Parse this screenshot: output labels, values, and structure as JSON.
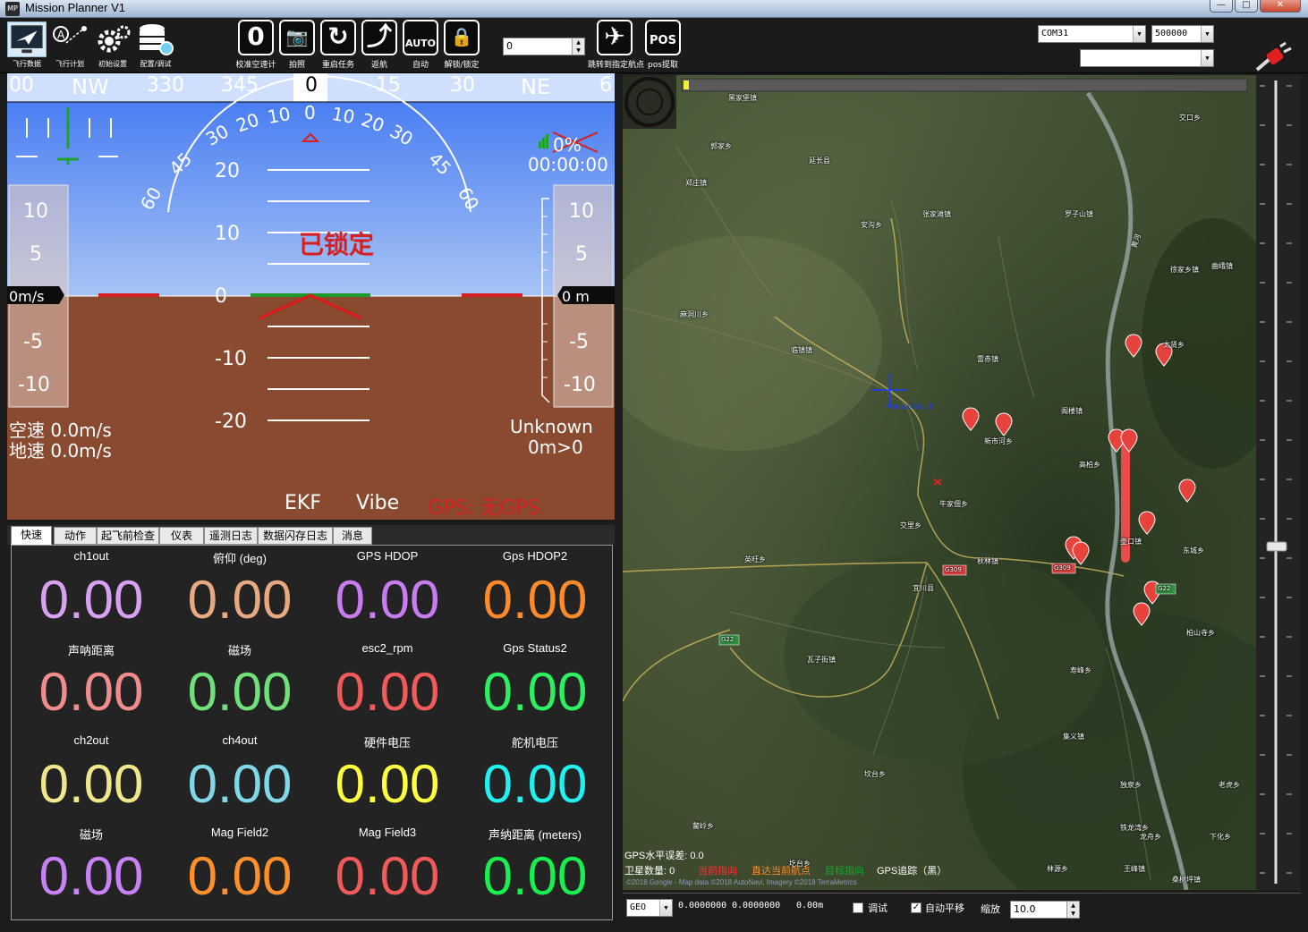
{
  "window": {
    "title": "Mission Planner V1",
    "icon_text": "MP",
    "minimize": "—",
    "maximize": "□",
    "close": "✕"
  },
  "nav": [
    {
      "label": "飞行数据"
    },
    {
      "label": "飞行计划"
    },
    {
      "label": "初始设置"
    },
    {
      "label": "配置/调试"
    }
  ],
  "actions": [
    {
      "symbol": "0",
      "label": "校准空速计"
    },
    {
      "symbol": "📷",
      "label": "拍照"
    },
    {
      "symbol": "↻",
      "label": "重启任务"
    },
    {
      "symbol": "⤴",
      "label": "返航"
    },
    {
      "symbol": "AUTO",
      "label": "自动"
    },
    {
      "symbol": "🔒",
      "label": "解锁/锁定"
    },
    {
      "symbol": "✈",
      "label": "跳转到指定航点"
    },
    {
      "symbol": "POS",
      "label": "pos提取"
    }
  ],
  "waypoint_spin": {
    "value": "0"
  },
  "connection": {
    "port": "COM31",
    "baud": "500000",
    "link_stats": "",
    "connect_label": "连接"
  },
  "hud": {
    "heading_tape": [
      "00",
      "NW",
      "330",
      "345",
      "0",
      "15",
      "30",
      "NE",
      "6"
    ],
    "roll_scale": [
      "60",
      "45",
      "30",
      "20",
      "10",
      "0",
      "10",
      "20",
      "30",
      "45",
      "60"
    ],
    "pitch_labels": [
      "20",
      "10",
      "0",
      "-10",
      "-20"
    ],
    "speed_tape": [
      "10",
      "5",
      "-5",
      "-10"
    ],
    "alt_tape": [
      "10",
      "5",
      "-5",
      "-10"
    ],
    "speed_readout": "0m/s",
    "alt_readout": "0 m",
    "status_text": "已锁定",
    "battery_percent": "0%",
    "flight_timer": "00:00:00",
    "airspeed": "空速 0.0m/s",
    "groundspeed": "地速 0.0m/s",
    "mode": "Unknown",
    "wp_distance": "0m>0",
    "ekf": "EKF",
    "vibe": "Vibe",
    "gps": "GPS: 无GPS"
  },
  "tabs": [
    "快速",
    "动作",
    "起飞前检查",
    "仪表",
    "遥测日志",
    "数据闪存日志",
    "消息"
  ],
  "quick": [
    {
      "name": "ch1out",
      "value": "0.00",
      "color": "#d8a0f0"
    },
    {
      "name": "俯仰 (deg)",
      "value": "0.00",
      "color": "#e8a880"
    },
    {
      "name": "GPS HDOP",
      "value": "0.00",
      "color": "#c87cf0"
    },
    {
      "name": "Gps HDOP2",
      "value": "0.00",
      "color": "#ff8a2a"
    },
    {
      "name": "声呐距离",
      "value": "0.00",
      "color": "#f08c8c"
    },
    {
      "name": "磁场",
      "value": "0.00",
      "color": "#6fe07a"
    },
    {
      "name": "esc2_rpm",
      "value": "0.00",
      "color": "#f05a5a"
    },
    {
      "name": "Gps Status2",
      "value": "0.00",
      "color": "#2df060"
    },
    {
      "name": "ch2out",
      "value": "0.00",
      "color": "#f0e68c"
    },
    {
      "name": "ch4out",
      "value": "0.00",
      "color": "#7fd8e8"
    },
    {
      "name": "硬件电压",
      "value": "0.00",
      "color": "#ffff40"
    },
    {
      "name": "舵机电压",
      "value": "0.00",
      "color": "#20f0f0"
    },
    {
      "name": "磁场",
      "value": "0.00",
      "color": "#c882f5"
    },
    {
      "name": "Mag Field2",
      "value": "0.00",
      "color": "#ff8f2a"
    },
    {
      "name": "Mag Field3",
      "value": "0.00",
      "color": "#f05a5a"
    },
    {
      "name": "声纳距离 (meters)",
      "value": "0.00",
      "color": "#18f050"
    }
  ],
  "map": {
    "places": [
      "黑家堡镇",
      "郭家乡",
      "延长县",
      "郑庄镇",
      "交口乡",
      "张家滩镇",
      "罗子山镇",
      "安沟乡",
      "徐家乡镇",
      "曲峨镇",
      "麻洞川乡",
      "临镇镇",
      "雷赤镇",
      "新市河乡",
      "阁楼镇",
      "高柏乡",
      "牛家佃乡",
      "交里乡",
      "英旺乡",
      "秋林镇",
      "宜川县",
      "东城乡",
      "瓦子街镇",
      "柏山寺乡",
      "寿峰乡",
      "坎台乡",
      "鳖岭乡",
      "独泉乡",
      "圪台乡",
      "林源乡",
      "王峰镇",
      "桑树坪镇",
      "下化乡",
      "老虎乡",
      "集义镇",
      "壶口镇",
      "龙舟乡",
      "铁龙湾乡",
      "太贤乡"
    ],
    "road_labels": [
      "G309",
      "G309",
      "G22",
      "G22"
    ],
    "river_label": "黄河",
    "home_label": "Manual Build",
    "gps_hdop": "GPS水平误差: 0.0",
    "satellites": "卫星数量: 0",
    "current_heading": "当前指向",
    "to_current_wp": "直达当前航点",
    "target_heading": "目标指向",
    "gps_track": "GPS追踪（黑）",
    "copyright": "©2018 Google - Map data ©2018 AutoNavi, Imagery ©2018 TerraMetrics"
  },
  "map_bar": {
    "coord_system": "GEO",
    "lat": "0.0000000",
    "lng": "0.0000000",
    "alt": "0.00m",
    "debug_label": "调试",
    "debug_checked": false,
    "autopan_label": "自动平移",
    "autopan_checked": true,
    "zoom_label": "缩放",
    "zoom_value": "10.0"
  },
  "colors": {
    "sky": "#4f85f5",
    "ground": "#8a4a30",
    "red": "#d42020",
    "heading_bg": "#cfe0ff"
  }
}
